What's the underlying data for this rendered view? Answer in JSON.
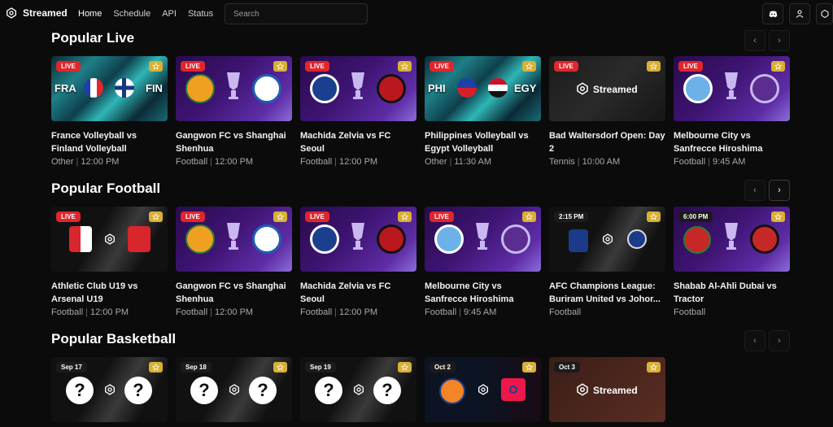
{
  "header": {
    "brand": "Streamed",
    "nav": [
      "Home",
      "Schedule",
      "API",
      "Status"
    ],
    "search_placeholder": "Search",
    "icons": [
      "discord-icon",
      "user-icon",
      "theme-icon"
    ]
  },
  "sections": [
    {
      "title": "Popular Live",
      "cards": [
        {
          "badge": "LIVE",
          "title": "France Volleyball vs Finland Volleyball",
          "category": "Other",
          "time": "12:00 PM",
          "home_code": "FRA",
          "away_code": "FIN"
        },
        {
          "badge": "LIVE",
          "title": "Gangwon FC vs Shanghai Shenhua",
          "category": "Football",
          "time": "12:00 PM"
        },
        {
          "badge": "LIVE",
          "title": "Machida Zelvia vs FC Seoul",
          "category": "Football",
          "time": "12:00 PM"
        },
        {
          "badge": "LIVE",
          "title": "Philippines Volleyball vs Egypt Volleyball",
          "category": "Other",
          "time": "11:30 AM",
          "home_code": "PHI",
          "away_code": "EGY"
        },
        {
          "badge": "LIVE",
          "title": "Bad Waltersdorf Open: Day 2",
          "category": "Tennis",
          "time": "10:00 AM",
          "placeholder": "Streamed"
        },
        {
          "badge": "LIVE",
          "title": "Melbourne City vs Sanfrecce Hiroshima",
          "category": "Football",
          "time": "9:45 AM"
        }
      ]
    },
    {
      "title": "Popular Football",
      "cards": [
        {
          "badge": "LIVE",
          "title": "Athletic Club U19 vs Arsenal U19",
          "category": "Football",
          "time": "12:00 PM"
        },
        {
          "badge": "LIVE",
          "title": "Gangwon FC vs Shanghai Shenhua",
          "category": "Football",
          "time": "12:00 PM"
        },
        {
          "badge": "LIVE",
          "title": "Machida Zelvia vs FC Seoul",
          "category": "Football",
          "time": "12:00 PM"
        },
        {
          "badge": "LIVE",
          "title": "Melbourne City vs Sanfrecce Hiroshima",
          "category": "Football",
          "time": "9:45 AM"
        },
        {
          "badge": "2:15 PM",
          "title": "AFC Champions League: Buriram United vs Johor...",
          "category": "Football",
          "time": ""
        },
        {
          "badge": "6:00 PM",
          "title": "Shabab Al-Ahli Dubai vs Tractor",
          "category": "Football",
          "time": ""
        }
      ]
    },
    {
      "title": "Popular Basketball",
      "cards": [
        {
          "badge": "Sep 17"
        },
        {
          "badge": "Sep 18"
        },
        {
          "badge": "Sep 19"
        },
        {
          "badge": "Oct 2"
        },
        {
          "badge": "Oct 3",
          "placeholder": "Streamed"
        }
      ]
    }
  ],
  "colors": {
    "live": "#e0262c",
    "favorite": "#d9b035",
    "background": "#0b0b0b"
  }
}
